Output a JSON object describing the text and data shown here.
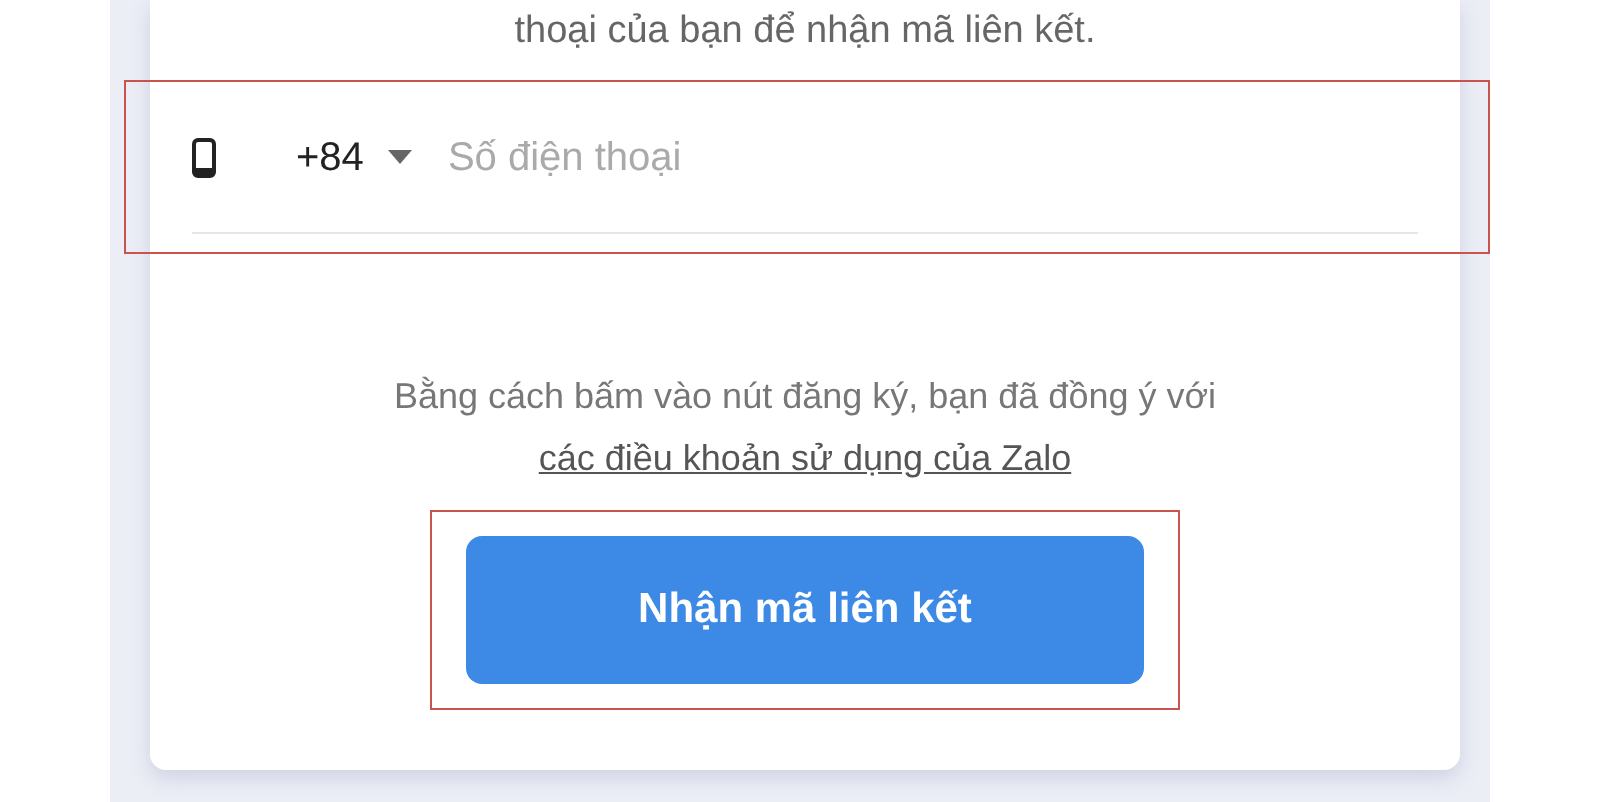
{
  "intro_text": "thoại của bạn để nhận mã liên kết.",
  "phone_field": {
    "country_code": "+84",
    "placeholder": "Số điện thoại",
    "highlighted": true
  },
  "terms": {
    "text": "Bằng cách bấm vào nút đăng ký, bạn đã đồng ý với",
    "link": "các điều khoản sử dụng của Zalo"
  },
  "submit_button": {
    "label": "Nhận mã liên kết",
    "highlighted": true
  }
}
